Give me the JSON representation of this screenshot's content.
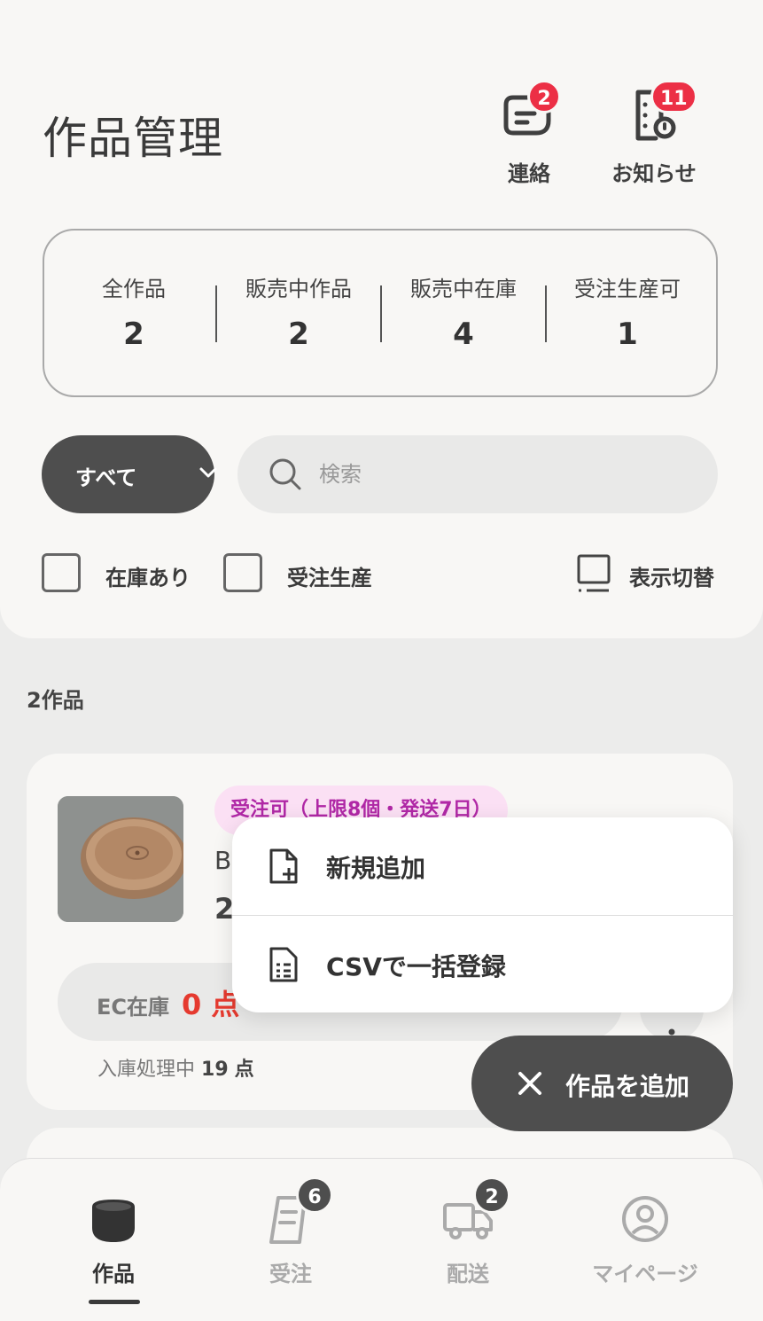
{
  "header": {
    "title": "作品管理",
    "contact": {
      "label": "連絡",
      "badge": "2",
      "icon": "chat-bubble-icon"
    },
    "notice": {
      "label": "お知らせ",
      "badge": "11",
      "icon": "notice-document-icon"
    }
  },
  "stats": [
    {
      "label": "全作品",
      "value": "2"
    },
    {
      "label": "販売中作品",
      "value": "2"
    },
    {
      "label": "販売中在庫",
      "value": "4"
    },
    {
      "label": "受注生産可",
      "value": "1"
    }
  ],
  "filter": {
    "label": "すべて"
  },
  "search": {
    "placeholder": "検索",
    "value": ""
  },
  "checkboxes": {
    "in_stock": "在庫あり",
    "made_to_order": "受注生産"
  },
  "toggle_view": {
    "label": "表示切替"
  },
  "list": {
    "count_label": "2作品"
  },
  "product": {
    "tag": "受注可（上限8個・発送7日）",
    "name_partial": "B",
    "price_partial": "2",
    "stock_label": "EC在庫",
    "stock_value": "0 点",
    "inbound_label": "入庫処理中",
    "inbound_value": "19",
    "inbound_unit": "点"
  },
  "menu": {
    "new": "新規追加",
    "csv": "CSVで一括登録"
  },
  "fab": {
    "label": "作品を追加"
  },
  "nav": [
    {
      "label": "作品",
      "badge": ""
    },
    {
      "label": "受注",
      "badge": "6"
    },
    {
      "label": "配送",
      "badge": "2"
    },
    {
      "label": "マイページ",
      "badge": ""
    }
  ],
  "colors": {
    "badge_red": "#ec2f45",
    "dark": "#4e4e4e",
    "stock_red": "#e53a2f",
    "tag_pink": "#b028a6"
  }
}
